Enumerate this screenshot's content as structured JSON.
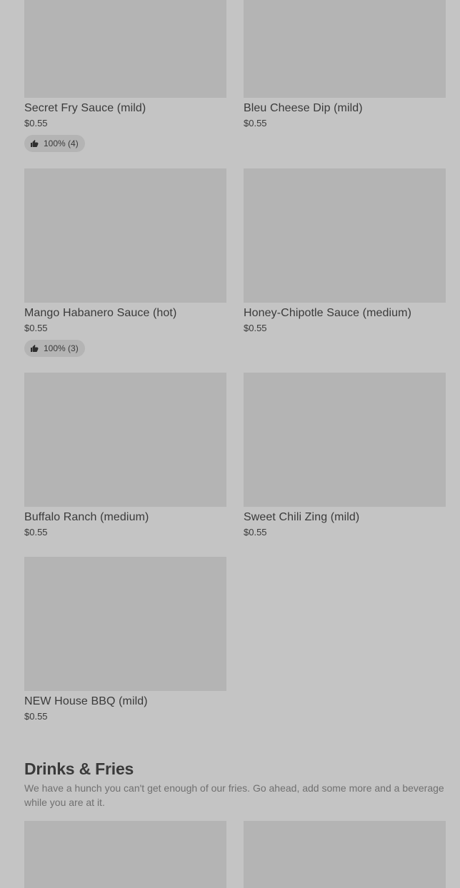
{
  "items": [
    {
      "name": "Secret Fry Sauce (mild)",
      "price": "$0.55",
      "rating": "100% (4)"
    },
    {
      "name": "Bleu Cheese Dip (mild)",
      "price": "$0.55"
    },
    {
      "name": "Mango Habanero Sauce (hot)",
      "price": "$0.55",
      "rating": "100% (3)"
    },
    {
      "name": "Honey-Chipotle Sauce (medium)",
      "price": "$0.55"
    },
    {
      "name": "Buffalo Ranch (medium)",
      "price": "$0.55"
    },
    {
      "name": "Sweet Chili Zing (mild)",
      "price": "$0.55"
    },
    {
      "name": "NEW House BBQ (mild)",
      "price": "$0.55"
    }
  ],
  "section": {
    "title": "Drinks & Fries",
    "description": "We have a hunch you can't get enough of our fries. Go ahead, add some more and a beverage while you are at it."
  },
  "icons": {
    "rating": "thumbs-up-icon"
  }
}
